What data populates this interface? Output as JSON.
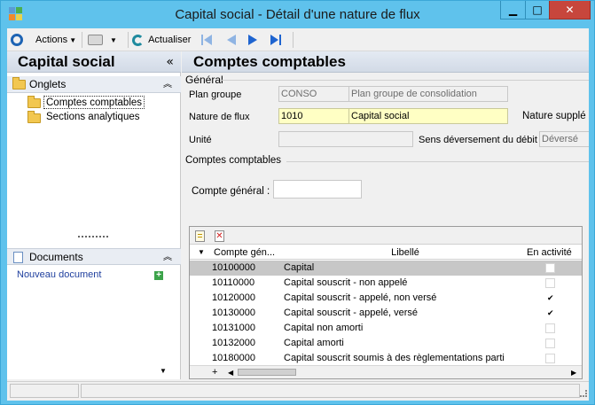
{
  "window": {
    "title": "Capital social -  Détail d'une nature de flux",
    "buttons": {
      "minimize": "▁",
      "maximize": "□",
      "close": "✕"
    }
  },
  "toolbar": {
    "actions_label": "Actions",
    "refresh_label": "Actualiser"
  },
  "left_panel": {
    "title": "Capital social",
    "collapse_glyph": "«",
    "onglets": {
      "label": "Onglets",
      "items": [
        "Comptes comptables",
        "Sections analytiques"
      ]
    },
    "documents": {
      "label": "Documents",
      "new_document": "Nouveau document"
    }
  },
  "main": {
    "title": "Comptes comptables",
    "general": {
      "section_label": "Général",
      "plan_groupe_label": "Plan groupe",
      "plan_groupe_code": "CONSO",
      "plan_groupe_desc": "Plan groupe de consolidation",
      "nature_flux_label": "Nature de flux",
      "nature_flux_code": "1010",
      "nature_flux_desc": "Capital social",
      "nature_suppl_label": "Nature supplé",
      "unite_label": "Unité",
      "unite_value": "",
      "sens_label": "Sens déversement du débit",
      "sens_value": "Déversé"
    },
    "comptes": {
      "section_label": "Comptes comptables",
      "compte_general_label": "Compte général :",
      "compte_general_value": ""
    },
    "grid": {
      "columns": [
        "Compte gén...",
        "Libellé",
        "En activité"
      ],
      "rows": [
        {
          "code": "10100000",
          "label": "Capital",
          "active": false
        },
        {
          "code": "10110000",
          "label": "Capital souscrit - non appelé",
          "active": false
        },
        {
          "code": "10120000",
          "label": "Capital souscrit - appelé, non versé",
          "active": true
        },
        {
          "code": "10130000",
          "label": "Capital souscrit - appelé, versé",
          "active": true
        },
        {
          "code": "10131000",
          "label": "Capital non amorti",
          "active": false
        },
        {
          "code": "10132000",
          "label": "Capital amorti",
          "active": false
        },
        {
          "code": "10180000",
          "label": "Capital souscrit soumis à des règlementations parti",
          "active": false
        }
      ]
    }
  },
  "colors": {
    "title_bar": "#5fc2ec",
    "selected_row": "#c7c7c7",
    "highlight_field": "#ffffc4",
    "accent_blue": "#1e64b4"
  }
}
